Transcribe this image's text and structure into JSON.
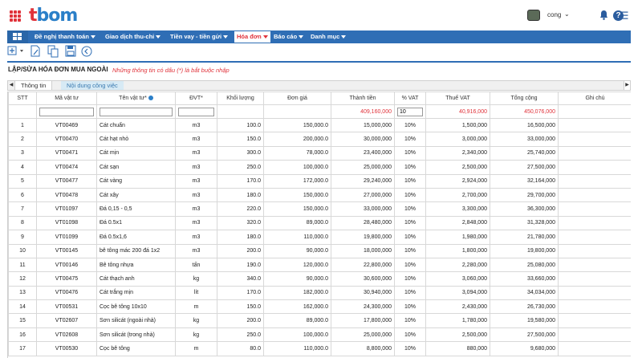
{
  "app": {
    "logo_text": "bom",
    "logo_prefix": "t",
    "user_name": "cong",
    "help_glyph": "?"
  },
  "nav": {
    "items": [
      {
        "label": "Đề nghị thanh toán",
        "active": false
      },
      {
        "label": "Giao dịch thu-chi",
        "active": false
      },
      {
        "label": "Tiền vay - tiền gửi",
        "active": false
      },
      {
        "label": "Hóa đơn",
        "active": true
      },
      {
        "label": "Báo cáo",
        "active": false
      },
      {
        "label": "Danh mục",
        "active": false
      }
    ]
  },
  "form": {
    "title": "LẬP/SỬA HÓA ĐƠN MUA NGOÀI",
    "note": "Những thông tin có dấu (*) là bắt buộc nhập"
  },
  "tabs": [
    {
      "label": "Thông tin"
    },
    {
      "label": "Nội dung công việc"
    }
  ],
  "grid": {
    "columns": [
      "STT",
      "Mã vật tư",
      "Tên vật tư*",
      "ĐVT*",
      "Khối lượng",
      "Đơn giá",
      "Thành tiền",
      "% VAT",
      "Thuế VAT",
      "Tổng cộng",
      "Ghi chú"
    ],
    "vat_filter_value": "10",
    "totals": {
      "thanh_tien": "409,160,000",
      "thue_vat": "40,916,000",
      "tong_cong": "450,076,000"
    },
    "rows": [
      [
        "1",
        "VT00469",
        "Cát chuẩn",
        "m3",
        "100.0",
        "150,000.0",
        "15,000,000",
        "10%",
        "1,500,000",
        "16,500,000",
        ""
      ],
      [
        "2",
        "VT00470",
        "Cát hạt nhỏ",
        "m3",
        "150.0",
        "200,000.0",
        "30,000,000",
        "10%",
        "3,000,000",
        "33,000,000",
        ""
      ],
      [
        "3",
        "VT00471",
        "Cát mịn",
        "m3",
        "300.0",
        "78,000.0",
        "23,400,000",
        "10%",
        "2,340,000",
        "25,740,000",
        ""
      ],
      [
        "4",
        "VT00474",
        "Cát sạn",
        "m3",
        "250.0",
        "100,000.0",
        "25,000,000",
        "10%",
        "2,500,000",
        "27,500,000",
        ""
      ],
      [
        "5",
        "VT00477",
        "Cát vàng",
        "m3",
        "170.0",
        "172,000.0",
        "29,240,000",
        "10%",
        "2,924,000",
        "32,164,000",
        ""
      ],
      [
        "6",
        "VT00478",
        "Cát xây",
        "m3",
        "180.0",
        "150,000.0",
        "27,000,000",
        "10%",
        "2,700,000",
        "29,700,000",
        ""
      ],
      [
        "7",
        "VT01097",
        "Đá 0,15 - 0,5",
        "m3",
        "220.0",
        "150,000.0",
        "33,000,000",
        "10%",
        "3,300,000",
        "36,300,000",
        ""
      ],
      [
        "8",
        "VT01098",
        "Đá 0.5x1",
        "m3",
        "320.0",
        "89,000.0",
        "28,480,000",
        "10%",
        "2,848,000",
        "31,328,000",
        ""
      ],
      [
        "9",
        "VT01099",
        "Đá 0.5x1,6",
        "m3",
        "180.0",
        "110,000.0",
        "19,800,000",
        "10%",
        "1,980,000",
        "21,780,000",
        ""
      ],
      [
        "10",
        "VT00145",
        "bê tông mác 200 đá 1x2",
        "m3",
        "200.0",
        "90,000.0",
        "18,000,000",
        "10%",
        "1,800,000",
        "19,800,000",
        ""
      ],
      [
        "11",
        "VT00146",
        "Bê tông nhựa",
        "tấn",
        "190.0",
        "120,000.0",
        "22,800,000",
        "10%",
        "2,280,000",
        "25,080,000",
        ""
      ],
      [
        "12",
        "VT00475",
        "Cát thạch anh",
        "kg",
        "340.0",
        "90,000.0",
        "30,600,000",
        "10%",
        "3,060,000",
        "33,660,000",
        ""
      ],
      [
        "13",
        "VT00476",
        "Cát trắng mịn",
        "lít",
        "170.0",
        "182,000.0",
        "30,940,000",
        "10%",
        "3,094,000",
        "34,034,000",
        ""
      ],
      [
        "14",
        "VT00531",
        "Cọc bê tông 10x10",
        "m",
        "150.0",
        "162,000.0",
        "24,300,000",
        "10%",
        "2,430,000",
        "26,730,000",
        ""
      ],
      [
        "15",
        "VT02607",
        "Sơn silicát (ngoài nhà)",
        "kg",
        "200.0",
        "89,000.0",
        "17,800,000",
        "10%",
        "1,780,000",
        "19,580,000",
        ""
      ],
      [
        "16",
        "VT02608",
        "Sơn silicát (trong nhà)",
        "kg",
        "250.0",
        "100,000.0",
        "25,000,000",
        "10%",
        "2,500,000",
        "27,500,000",
        ""
      ],
      [
        "17",
        "VT00530",
        "Cọc bê tông",
        "m",
        "80.0",
        "110,000.0",
        "8,800,000",
        "10%",
        "880,000",
        "9,680,000",
        ""
      ]
    ]
  },
  "colors": {
    "brand_blue": "#2f6eb5",
    "brand_red": "#e0323a"
  }
}
